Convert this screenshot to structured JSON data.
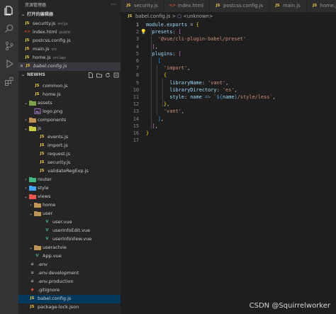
{
  "explorer": {
    "title": "资源管理器",
    "more": "···",
    "open_editors": {
      "label": "打开的编辑器",
      "items": [
        {
          "icon": "JS",
          "name": "security.js",
          "desc": "src\\js"
        },
        {
          "icon": "<>",
          "name": "index.html",
          "desc": "public"
        },
        {
          "icon": "JS",
          "name": "postcss.config.js",
          "desc": ""
        },
        {
          "icon": "JS",
          "name": "main.js",
          "desc": "src"
        },
        {
          "icon": "JS",
          "name": "home.js",
          "desc": "src\\api"
        },
        {
          "icon": "JS",
          "name": "babel.config.js",
          "desc": ""
        }
      ]
    },
    "project": {
      "label": "NEWHS",
      "tree": [
        {
          "icon": "JS",
          "name": "common.js"
        },
        {
          "icon": "JS",
          "name": "home.js"
        },
        {
          "icon": "folder",
          "name": "assets"
        },
        {
          "icon": "img",
          "name": "logo.png"
        },
        {
          "icon": "folder",
          "name": "components"
        },
        {
          "icon": "folder",
          "name": "js"
        },
        {
          "icon": "JS",
          "name": "events.js"
        },
        {
          "icon": "JS",
          "name": "import.js"
        },
        {
          "icon": "JS",
          "name": "request.js"
        },
        {
          "icon": "JS",
          "name": "security.js"
        },
        {
          "icon": "JS",
          "name": "validateRegExp.js"
        },
        {
          "icon": "folder",
          "name": "router"
        },
        {
          "icon": "folder",
          "name": "style"
        },
        {
          "icon": "folder",
          "name": "views"
        },
        {
          "icon": "folder",
          "name": "home"
        },
        {
          "icon": "folder",
          "name": "user"
        },
        {
          "icon": "V",
          "name": "user.vue"
        },
        {
          "icon": "V",
          "name": "userInfoEdit.vue"
        },
        {
          "icon": "V",
          "name": "userInfoView.vue"
        },
        {
          "icon": "folder",
          "name": "useractvie"
        },
        {
          "icon": "V",
          "name": "App.vue"
        },
        {
          "icon": "env",
          "name": ".env"
        },
        {
          "icon": "env",
          "name": ".env.development"
        },
        {
          "icon": "env",
          "name": ".env.production"
        },
        {
          "icon": "git",
          "name": ".gitignore"
        },
        {
          "icon": "JS",
          "name": "babel.config.js"
        },
        {
          "icon": "JS",
          "name": "package-lock.json"
        }
      ]
    }
  },
  "tabs": [
    {
      "icon": "JS",
      "label": "security.js",
      "active": false
    },
    {
      "icon": "<>",
      "label": "index.html",
      "active": false
    },
    {
      "icon": "JS",
      "label": "postcss.config.js",
      "active": false
    },
    {
      "icon": "JS",
      "label": "main.js",
      "active": false
    },
    {
      "icon": "JS",
      "label": "home.js",
      "active": false
    }
  ],
  "breadcrumb": {
    "file": "babel.config.js",
    "separator": ">",
    "symbol": "<unknown>"
  },
  "editor": {
    "current_line": 1,
    "lines": [
      "module.exports = {",
      "  presets: [",
      "    '@vue/cli-plugin-babel/preset'",
      "  ],",
      "  plugins: [",
      "    [",
      "      'import',",
      "      {",
      "        libraryName: 'vant',",
      "        libraryDirectory: 'es',",
      "        style: name => `${name}/style/less`,",
      "      },",
      "      'vant',",
      "    ],",
      "  ],",
      "}",
      ""
    ]
  },
  "watermark": "CSDN @Squirrelworker",
  "colors": {
    "activity_bar": "#333333",
    "sidebar": "#252526",
    "editor": "#1e1e1e",
    "js_icon": "#e8c33a",
    "vue_icon": "#41b883",
    "html_icon": "#e44d26"
  }
}
